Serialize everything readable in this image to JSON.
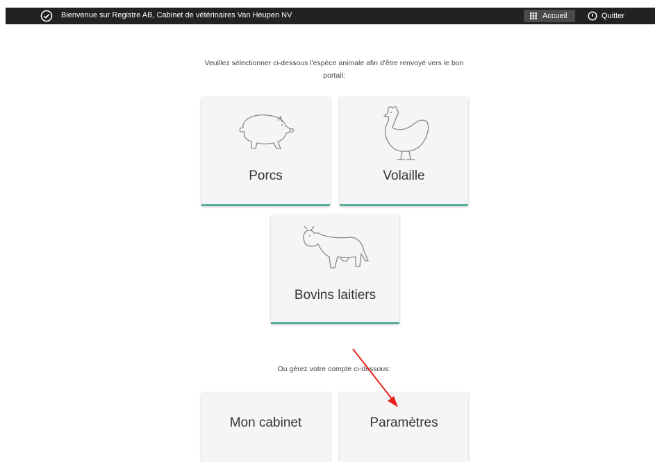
{
  "topbar": {
    "welcome": "Bienvenue sur Registre AB, Cabinet de vétérinaires Van Heupen NV",
    "home_label": "Accueil",
    "quit_label": "Quitter"
  },
  "intro_text": "Veuillez sélectionner ci-dessous l'espèce animale afin d'être renvoyé vers le bon portail:",
  "species": [
    {
      "label": "Porcs",
      "icon": "pig-icon"
    },
    {
      "label": "Volaille",
      "icon": "chicken-icon"
    },
    {
      "label": "Bovins laitiers",
      "icon": "cow-icon"
    }
  ],
  "account_text": "Ou gérez votre compte ci-dessous:",
  "account": [
    {
      "label": "Mon cabinet"
    },
    {
      "label": "Paramètres"
    }
  ],
  "colors": {
    "topbar": "#222222",
    "tile_bg": "#f5f5f5",
    "accent": "#5aaea0",
    "annotation_arrow": "#e8201a"
  }
}
